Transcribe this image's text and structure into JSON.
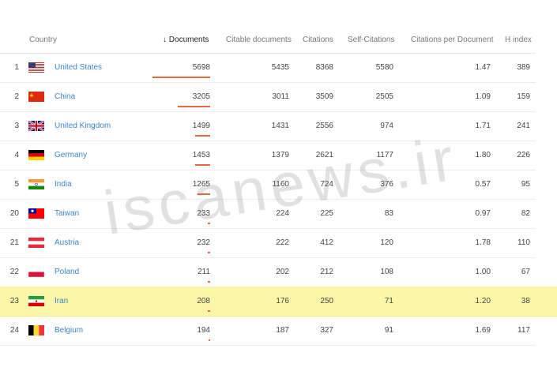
{
  "columns": {
    "country": "Country",
    "documents": "Documents",
    "citable": "Citable documents",
    "citations": "Citations",
    "self_citations": "Self-Citations",
    "cpd": "Citations per Document",
    "h_index": "H index"
  },
  "sort_icon": "arrow-down-icon",
  "colors": {
    "link": "#3a86c8",
    "bar": "#e8683a",
    "highlight": "#fbf7a8"
  },
  "rows": [
    {
      "rank": "1",
      "country": "United States",
      "flag": "us-flag-icon",
      "documents": "5698",
      "citable": "5435",
      "citations": "8368",
      "self_citations": "5580",
      "cpd": "1.47",
      "h_index": "389",
      "doc_bar": 1.0
    },
    {
      "rank": "2",
      "country": "China",
      "flag": "cn-flag-icon",
      "documents": "3205",
      "citable": "3011",
      "citations": "3509",
      "self_citations": "2505",
      "cpd": "1.09",
      "h_index": "159",
      "doc_bar": 0.56
    },
    {
      "rank": "3",
      "country": "United Kingdom",
      "flag": "gb-flag-icon",
      "documents": "1499",
      "citable": "1431",
      "citations": "2556",
      "self_citations": "974",
      "cpd": "1.71",
      "h_index": "241",
      "doc_bar": 0.26
    },
    {
      "rank": "4",
      "country": "Germany",
      "flag": "de-flag-icon",
      "documents": "1453",
      "citable": "1379",
      "citations": "2621",
      "self_citations": "1177",
      "cpd": "1.80",
      "h_index": "226",
      "doc_bar": 0.255
    },
    {
      "rank": "5",
      "country": "India",
      "flag": "in-flag-icon",
      "documents": "1265",
      "citable": "1160",
      "citations": "724",
      "self_citations": "376",
      "cpd": "0.57",
      "h_index": "95",
      "doc_bar": 0.22
    },
    {
      "rank": "20",
      "country": "Taiwan",
      "flag": "tw-flag-icon",
      "documents": "233",
      "citable": "224",
      "citations": "225",
      "self_citations": "83",
      "cpd": "0.97",
      "h_index": "82",
      "doc_bar": 0.04
    },
    {
      "rank": "21",
      "country": "Austria",
      "flag": "at-flag-icon",
      "documents": "232",
      "citable": "222",
      "citations": "412",
      "self_citations": "120",
      "cpd": "1.78",
      "h_index": "110",
      "doc_bar": 0.04
    },
    {
      "rank": "22",
      "country": "Poland",
      "flag": "pl-flag-icon",
      "documents": "211",
      "citable": "202",
      "citations": "212",
      "self_citations": "108",
      "cpd": "1.00",
      "h_index": "67",
      "doc_bar": 0.037
    },
    {
      "rank": "23",
      "country": "Iran",
      "flag": "ir-flag-icon",
      "documents": "208",
      "citable": "176",
      "citations": "250",
      "self_citations": "71",
      "cpd": "1.20",
      "h_index": "38",
      "doc_bar": 0.036,
      "highlighted": true
    },
    {
      "rank": "24",
      "country": "Belgium",
      "flag": "be-flag-icon",
      "documents": "194",
      "citable": "187",
      "citations": "327",
      "self_citations": "91",
      "cpd": "1.69",
      "h_index": "117",
      "doc_bar": 0.034
    }
  ],
  "watermark": "iscanews.ir"
}
